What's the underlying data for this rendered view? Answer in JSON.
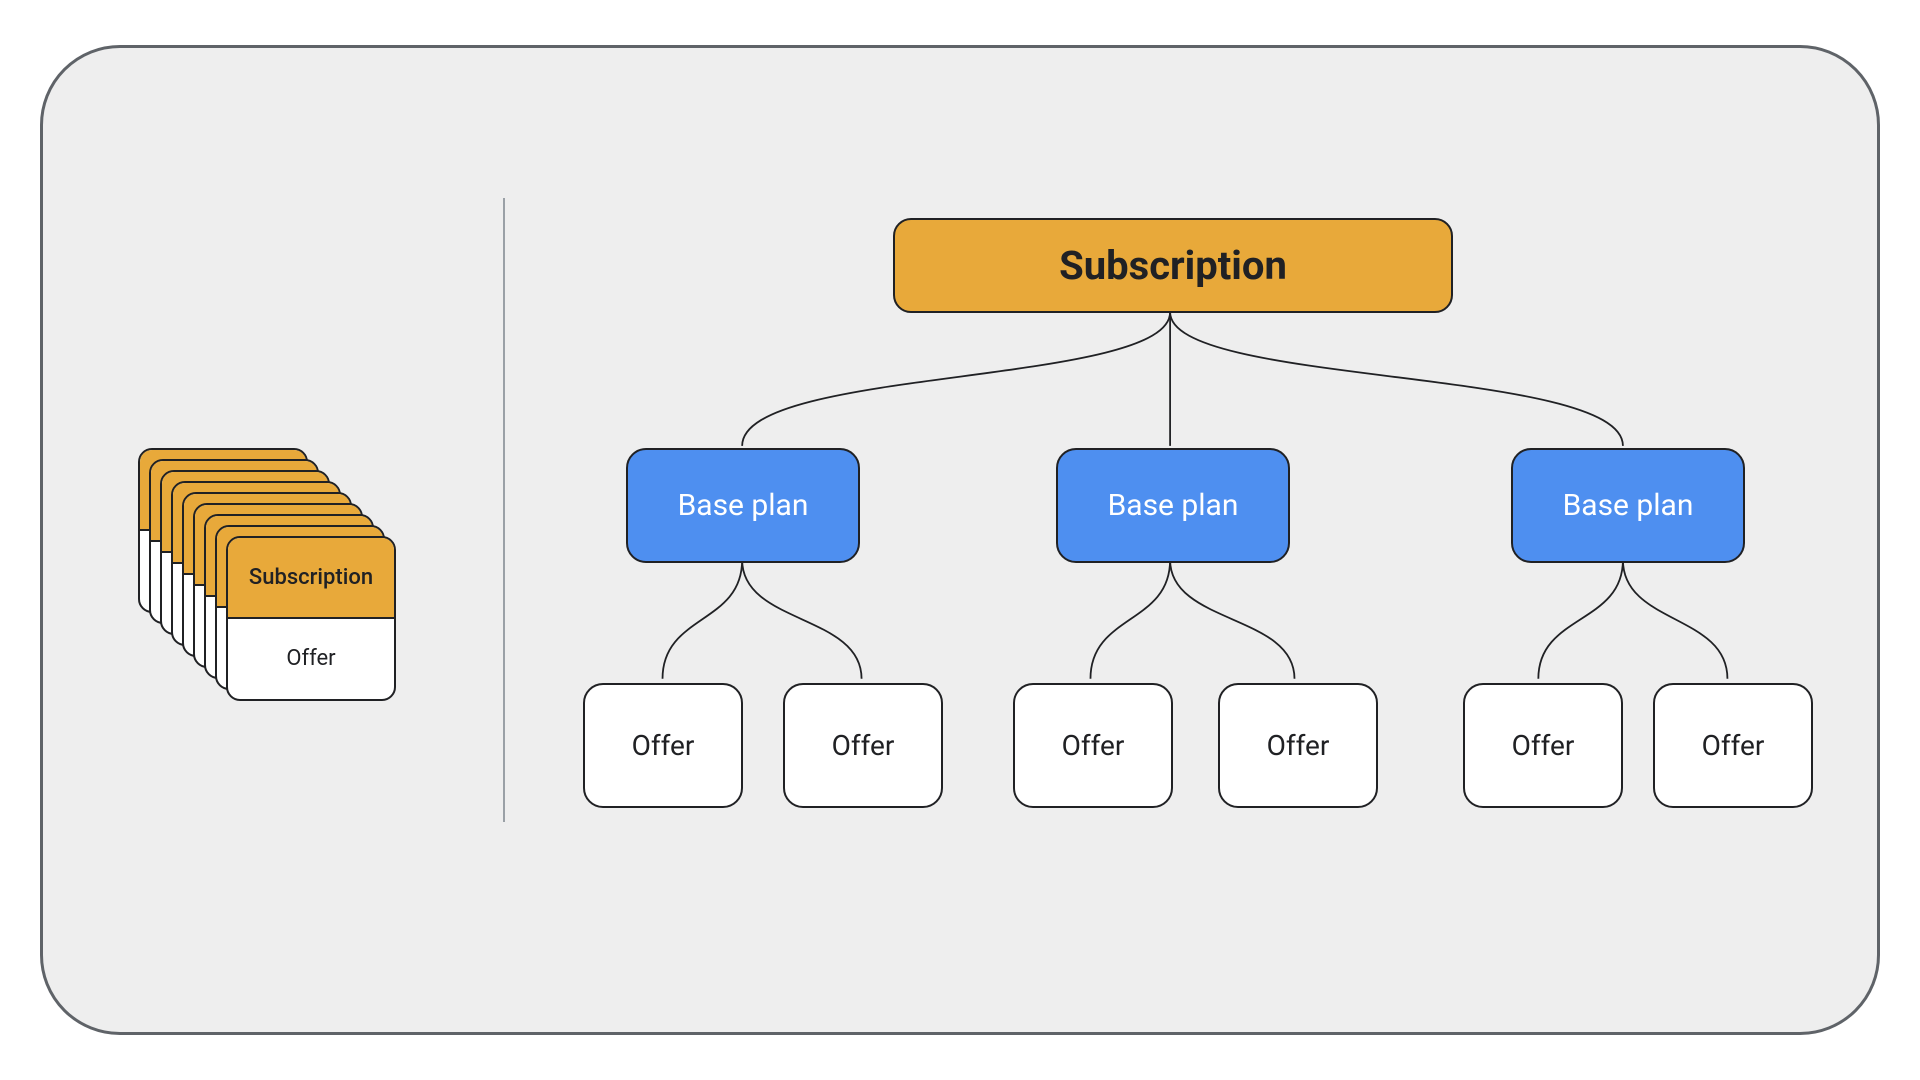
{
  "colors": {
    "frame_border": "#5f6368",
    "frame_bg": "#eeeeee",
    "divider": "#9aa0a6",
    "subscription_bg": "#e8a93a",
    "baseplan_bg": "#4e8ff0",
    "offer_bg": "#ffffff",
    "node_border": "#202124"
  },
  "left_stack": {
    "card_count": 9,
    "top_label": "Subscription",
    "bottom_label": "Offer"
  },
  "tree": {
    "root": {
      "label": "Subscription"
    },
    "baseplans": [
      {
        "label": "Base plan",
        "offers": [
          {
            "label": "Offer"
          },
          {
            "label": "Offer"
          }
        ]
      },
      {
        "label": "Base plan",
        "offers": [
          {
            "label": "Offer"
          },
          {
            "label": "Offer"
          }
        ]
      },
      {
        "label": "Base plan",
        "offers": [
          {
            "label": "Offer"
          },
          {
            "label": "Offer"
          }
        ]
      }
    ]
  }
}
